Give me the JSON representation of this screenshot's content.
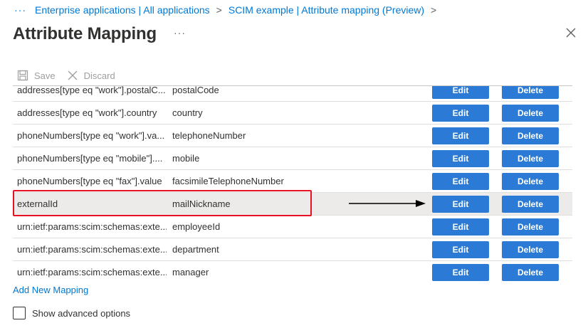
{
  "breadcrumb": {
    "ellipsis": "···",
    "items": [
      {
        "label": "Enterprise applications | All applications"
      },
      {
        "label": "SCIM example | Attribute mapping (Preview)"
      }
    ],
    "separator": ">"
  },
  "header": {
    "title": "Attribute Mapping",
    "more": "···"
  },
  "toolbar": {
    "save_label": "Save",
    "discard_label": "Discard"
  },
  "mappings": [
    {
      "source": "addresses[type eq \"work\"].postalC...",
      "target": "postalCode",
      "edit": "Edit",
      "delete": "Delete"
    },
    {
      "source": "addresses[type eq \"work\"].country",
      "target": "country",
      "edit": "Edit",
      "delete": "Delete"
    },
    {
      "source": "phoneNumbers[type eq \"work\"].va...",
      "target": "telephoneNumber",
      "edit": "Edit",
      "delete": "Delete"
    },
    {
      "source": "phoneNumbers[type eq \"mobile\"]....",
      "target": "mobile",
      "edit": "Edit",
      "delete": "Delete"
    },
    {
      "source": "phoneNumbers[type eq \"fax\"].value",
      "target": "facsimileTelephoneNumber",
      "edit": "Edit",
      "delete": "Delete"
    },
    {
      "source": "externalId",
      "target": "mailNickname",
      "edit": "Edit",
      "delete": "Delete"
    },
    {
      "source": "urn:ietf:params:scim:schemas:exte...",
      "target": "employeeId",
      "edit": "Edit",
      "delete": "Delete"
    },
    {
      "source": "urn:ietf:params:scim:schemas:exte...",
      "target": "department",
      "edit": "Edit",
      "delete": "Delete"
    },
    {
      "source": "urn:ietf:params:scim:schemas:exte...",
      "target": "manager",
      "edit": "Edit",
      "delete": "Delete"
    }
  ],
  "add_mapping_label": "Add New Mapping",
  "advanced_options_label": "Show advanced options",
  "colors": {
    "accent": "#0078d4",
    "button": "#2b7bd6",
    "annotation": "#e81123",
    "highlight_row": "#edebe9"
  },
  "icons": {
    "save": "save-icon",
    "discard": "discard-icon",
    "close": "close-icon"
  }
}
